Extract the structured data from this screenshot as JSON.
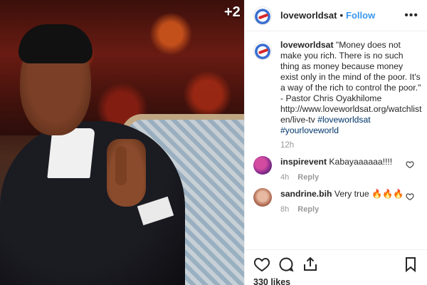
{
  "media": {
    "overlay_badge": "+2"
  },
  "post": {
    "username": "loveworldsat",
    "follow_label": "Follow",
    "separator": "•"
  },
  "caption": {
    "username": "loveworldsat",
    "text": "\"Money does not make you rich. There is no such thing as money because money exist only in the mind of the poor. It's a way of the rich to control the poor.\" - Pastor Chris Oyakhilome",
    "link": "http://www.loveworldsat.org/watchlisten/live-tv",
    "hashtags": "#loveworldsat #yourloveworld",
    "time": "12h"
  },
  "comments": [
    {
      "username": "inspirevent",
      "text": "Kabayaaaaaa!!!!",
      "time": "4h",
      "reply_label": "Reply"
    },
    {
      "username": "sandrine.bih",
      "text": "Very true 🔥🔥🔥",
      "time": "8h",
      "reply_label": "Reply"
    }
  ],
  "actions": {
    "likes": "330 likes",
    "icons": [
      "heart-icon",
      "comment-icon",
      "share-icon",
      "bookmark-icon"
    ]
  }
}
